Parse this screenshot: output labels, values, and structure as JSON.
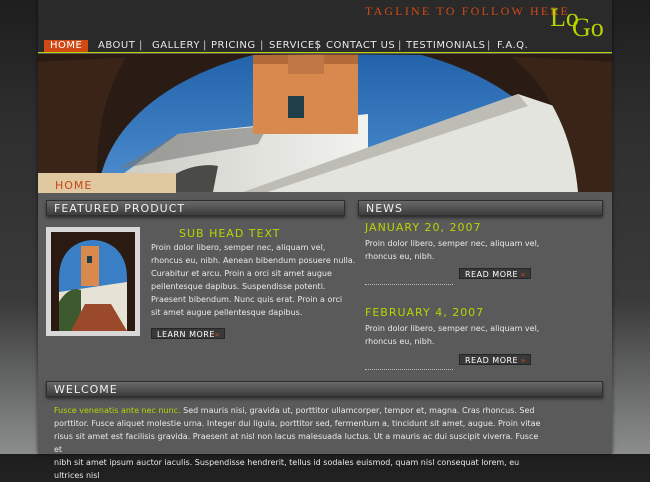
{
  "header": {
    "tagline": "TAGLINE TO FOLLOW HERE",
    "logo_part1": "Lo",
    "logo_part2": "Go"
  },
  "nav": {
    "items": [
      "HOME",
      "ABOUT",
      "GALLERY",
      "PRICING",
      "SERVICES",
      "CONTACT US",
      "TESTIMONIALS",
      "F.A.Q."
    ],
    "active": "HOME",
    "separator": "|"
  },
  "hero": {
    "tab_label": "HOME"
  },
  "featured": {
    "title": "FEATURED PRODUCT",
    "subhead": "SUB HEAD TEXT",
    "body_lines": [
      "Proin dolor libero, semper nec, aliquam vel,",
      "rhoncus eu, nibh. Aenean bibendum posuere nulla.",
      "Curabitur et arcu. Proin a orci sit amet augue",
      "pellentesque dapibus. Suspendisse potenti.",
      "Praesent bibendum. Nunc quis erat. Proin a orci",
      "sit amet augue pellentesque dapibus."
    ],
    "button_label": "LEARN MORE",
    "button_arrow": "»"
  },
  "news": {
    "title": "NEWS",
    "items": [
      {
        "date": "JANUARY 20, 2007",
        "lines": [
          "Proin dolor libero, semper nec, aliquam vel,",
          "rhoncus eu, nibh."
        ],
        "button_label": "READ MORE",
        "button_arrow": "»"
      },
      {
        "date": "FEBRUARY 4, 2007",
        "lines": [
          "Proin dolor libero, semper nec, aliquam vel,",
          "rhoncus eu, nibh."
        ],
        "button_label": "READ MORE",
        "button_arrow": "»"
      }
    ]
  },
  "welcome": {
    "title": "WELCOME",
    "highlight": "Fusce venenatis ante nec nunc.",
    "line1_rest": " Sed mauris nisi, gravida ut, porttitor ullamcorper, tempor et, magna. Cras rhoncus. Sed",
    "line2": "porttitor. Fusce aliquet molestie urna. Integer dui ligula, porttitor sed, fermentum a, tincidunt sit amet, augue. Proin vitae",
    "line3": "risus sit amet est facilisis gravida. Praesent at nisl non lacus malesuada luctus. Ut a mauris ac dui suscipit viverra. Fusce et",
    "line4": "nibh sit amet ipsum auctor iaculis. Suspendisse hendrerit, tellus id sodales euismod, quam nisl consequat lorem, eu ultrices nisl"
  },
  "colors": {
    "accent_orange": "#d14a15",
    "accent_green": "#b7d400",
    "panel": "#5b5a5b"
  }
}
